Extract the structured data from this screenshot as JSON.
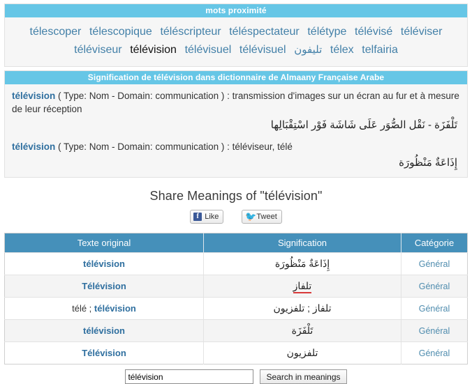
{
  "colors": {
    "panel_header_bg": "#66c6e6",
    "table_header_bg": "#4590ba",
    "link": "#4380a8",
    "headword": "#2f6f9f",
    "category": "#4f8cae",
    "error_underline": "#d83a3a"
  },
  "proximity": {
    "header": "mots proximité",
    "words": [
      {
        "text": "télescoper",
        "current": false,
        "arabic": false
      },
      {
        "text": "télescopique",
        "current": false,
        "arabic": false
      },
      {
        "text": "téléscripteur",
        "current": false,
        "arabic": false
      },
      {
        "text": "téléspectateur",
        "current": false,
        "arabic": false
      },
      {
        "text": "télétype",
        "current": false,
        "arabic": false
      },
      {
        "text": "télévisé",
        "current": false,
        "arabic": false
      },
      {
        "text": "téléviser",
        "current": false,
        "arabic": false
      },
      {
        "text": "téléviseur",
        "current": false,
        "arabic": false
      },
      {
        "text": "télévision",
        "current": true,
        "arabic": false
      },
      {
        "text": "télévisuel",
        "current": false,
        "arabic": false
      },
      {
        "text": "télévisuel",
        "current": false,
        "arabic": false
      },
      {
        "text": "تليفون",
        "current": false,
        "arabic": true
      },
      {
        "text": "télex",
        "current": false,
        "arabic": false
      },
      {
        "text": "telfairia",
        "current": false,
        "arabic": false
      }
    ]
  },
  "signification": {
    "header": "Signification de télévision dans dictionnaire de Almaany Française Arabe",
    "entries": [
      {
        "headword": "télévision",
        "meta": "( Type: Nom - Domain: communication ) : transmission d'images sur un écran au fur et à mesure de leur réception",
        "arabic": "تَلْفَزَة - نَقْل الصُّوَر عَلَى شَاشَة فَوْر اسْتِقْبَالِها"
      },
      {
        "headword": "télévision",
        "meta": "( Type: Nom - Domain: communication ) : téléviseur, télé",
        "arabic": "إِذَاعَةٌ مَنْظُورَة"
      }
    ]
  },
  "share": {
    "title": "Share Meanings of \"télévision\"",
    "facebook_label": "Like",
    "facebook_glyph": "f",
    "twitter_label": "Tweet",
    "twitter_glyph": "🐦"
  },
  "table": {
    "columns": [
      "Texte original",
      "Signification",
      "Catégorie"
    ],
    "rows": [
      {
        "original": "télévision",
        "original_plain": "",
        "meaning": "إِذَاعَةٌ مَنْظُورَة",
        "meaning_error": false,
        "category": "Général"
      },
      {
        "original": "Télévision",
        "original_plain": "",
        "meaning": "تلفاز",
        "meaning_error": true,
        "category": "Général"
      },
      {
        "original": "télévision",
        "original_plain": "télé ; ",
        "meaning": "تلفاز ; تلفزيون",
        "meaning_error": false,
        "category": "Général"
      },
      {
        "original": "télévision",
        "original_plain": "",
        "meaning": "تَلْفَزَة",
        "meaning_error": false,
        "category": "Général"
      },
      {
        "original": "Télévision",
        "original_plain": "",
        "meaning": "تلفزيون",
        "meaning_error": false,
        "category": "Général"
      }
    ]
  },
  "search": {
    "value": "télévision",
    "placeholder": "",
    "button_label": "Search in meanings"
  }
}
